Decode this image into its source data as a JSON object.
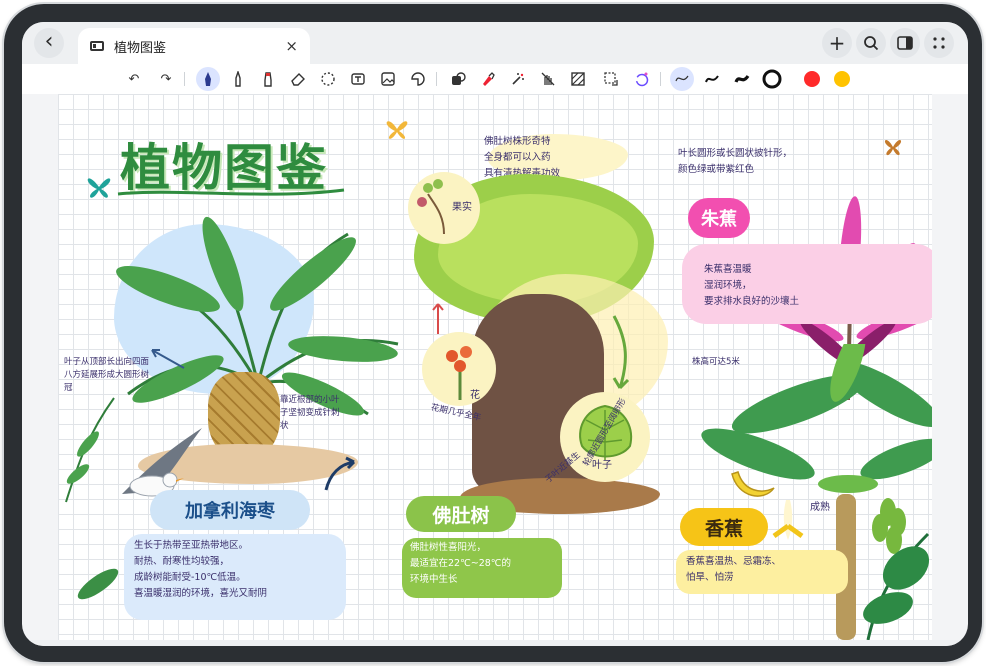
{
  "tab": {
    "title": "植物图鉴",
    "close_glyph": "×"
  },
  "window_controls": {
    "back": "‹",
    "add": "+",
    "search": "⌕",
    "more": "⋮⋮"
  },
  "toolbar": {
    "undo": "↶",
    "redo": "↷",
    "colors": [
      "#111111",
      "#ff2a2a",
      "#ffc300"
    ],
    "active_tool_bg": "#dbe4ff",
    "icons": [
      "undo-icon",
      "redo-icon",
      "fountain-pen-icon",
      "pen-icon",
      "marker-icon",
      "eraser-icon",
      "lasso-icon",
      "text-box-icon",
      "image-icon",
      "sticker-icon",
      "shape-icon",
      "brush-icon",
      "effects-icon",
      "hide-hand-icon",
      "texture-icon",
      "transform-icon",
      "ai-circle-icon",
      "stroke-wave-icon",
      "stroke-thin-icon",
      "stroke-thick-icon",
      "size-ring-icon"
    ]
  },
  "canvas": {
    "title": "植物图鉴",
    "canary": {
      "name": "加拿利海枣",
      "leaf_note": "叶子从顶部长出向四面八方延展形成大圆形树冠",
      "root_note": "靠近根部的小叶子坚韧变成针刺状",
      "description": [
        "生长于热带至亚热带地区。",
        "耐热、耐寒性均较强，",
        "成龄树能耐受-10℃低温。",
        "喜温暖湿润的环境，喜光又耐阴"
      ]
    },
    "bottle_tree": {
      "top_note": [
        "佛肚树株形奇特",
        "全身都可以入药",
        "具有清热解毒功效"
      ],
      "fruit_label": "果实",
      "flower_label": "花",
      "flower_note": "花期几乎全年",
      "leaf_label": "叶子",
      "leaf_note": "子叶近基生",
      "leaf_note2": "轮廓近圆形至阔卵形",
      "name": "佛肚树",
      "description": [
        "佛肚树性喜阳光，",
        "最适宜在22℃~28℃的",
        "环境中生长"
      ]
    },
    "ti_plant": {
      "top_note": [
        "叶长圆形或长圆状披针形，",
        "颜色绿或带紫红色"
      ],
      "name": "朱蕉",
      "description": [
        "朱蕉喜温暖",
        "湿润环境，",
        "要求排水良好的沙壤土"
      ]
    },
    "banana": {
      "height_note": "株高可达5米",
      "ripe_label": "成熟",
      "name": "香蕉",
      "description": [
        "香蕉喜温热、忌霜冻、",
        "怕旱、怕涝"
      ]
    }
  }
}
